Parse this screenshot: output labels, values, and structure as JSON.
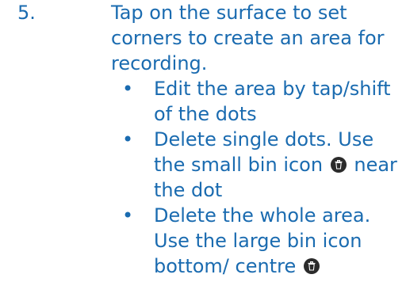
{
  "step": {
    "number": "5.",
    "text": "Tap on the surface to set corners to create an area for recording."
  },
  "bullet_marker": "•",
  "bullets": [
    {
      "text": "Edit the area by tap/shift of the dots"
    },
    {
      "text_before": "Delete single dots. Use the small bin icon",
      "text_after": "near the dot",
      "icon": "bin-icon"
    },
    {
      "text_before": "Delete the whole area. Use the large bin icon bottom/ centre",
      "icon": "bin-icon"
    }
  ],
  "colors": {
    "text": "#1a6bb0",
    "icon_background": "#2b2b2b",
    "icon_foreground": "#ffffff"
  }
}
